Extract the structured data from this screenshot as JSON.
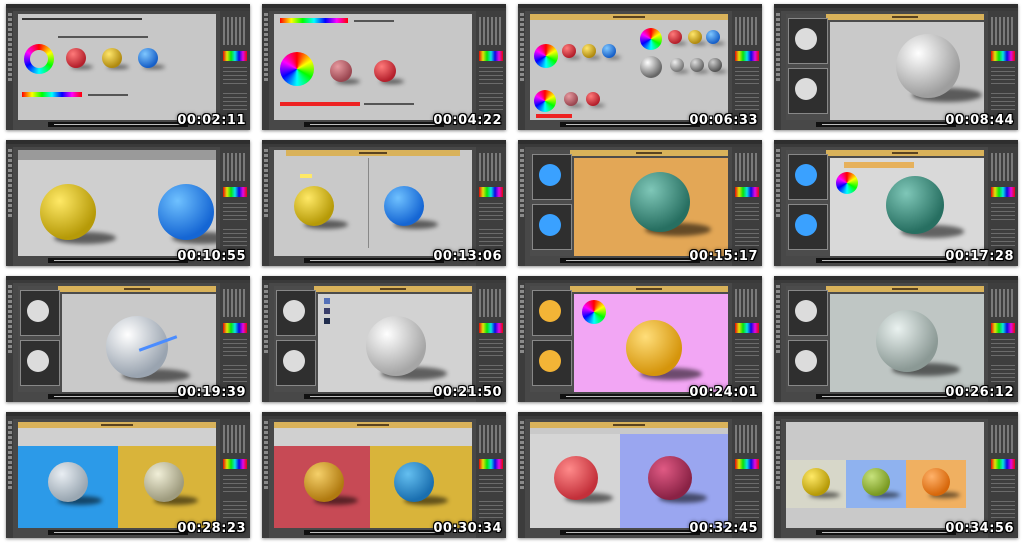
{
  "thumbnails": [
    {
      "timestamp": "00:02:11"
    },
    {
      "timestamp": "00:04:22"
    },
    {
      "timestamp": "00:06:33"
    },
    {
      "timestamp": "00:08:44"
    },
    {
      "timestamp": "00:10:55"
    },
    {
      "timestamp": "00:13:06"
    },
    {
      "timestamp": "00:15:17"
    },
    {
      "timestamp": "00:17:28"
    },
    {
      "timestamp": "00:19:39"
    },
    {
      "timestamp": "00:21:50"
    },
    {
      "timestamp": "00:24:01"
    },
    {
      "timestamp": "00:26:12"
    },
    {
      "timestamp": "00:28:23"
    },
    {
      "timestamp": "00:30:34"
    },
    {
      "timestamp": "00:32:45"
    },
    {
      "timestamp": "00:34:56"
    }
  ]
}
